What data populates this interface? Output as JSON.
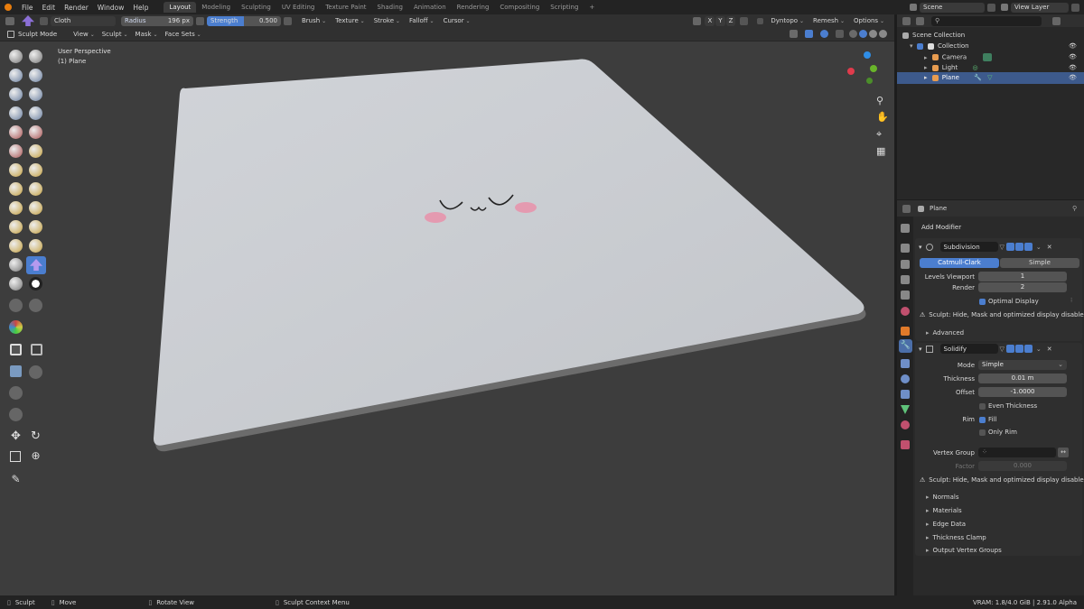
{
  "topbar": {
    "menus": [
      "File",
      "Edit",
      "Render",
      "Window",
      "Help"
    ],
    "workspaces": [
      "Layout",
      "Modeling",
      "Sculpting",
      "UV Editing",
      "Texture Paint",
      "Shading",
      "Animation",
      "Rendering",
      "Compositing",
      "Scripting"
    ],
    "active_workspace": "Layout",
    "add_tab": "+",
    "scene": "Scene",
    "view_layer": "View Layer"
  },
  "tool_header": {
    "brush_name": "Cloth",
    "radius_label": "Radius",
    "radius_value": "196 px",
    "strength_label": "Strength",
    "strength_value": "0.500",
    "menus": [
      "Brush",
      "Texture",
      "Stroke",
      "Falloff",
      "Cursor"
    ],
    "axes": [
      "X",
      "Y",
      "Z"
    ],
    "dyntopo": "Dyntopo",
    "remesh": "Remesh",
    "options": "Options"
  },
  "viewport_header": {
    "mode": "Sculpt Mode",
    "menus": [
      "View",
      "Sculpt",
      "Mask",
      "Face Sets"
    ]
  },
  "viewport": {
    "perspective": "User Perspective",
    "object": "(1) Plane",
    "face_text": "◡ ‿ ◡"
  },
  "outliner": {
    "root": "Scene Collection",
    "collection": "Collection",
    "items": [
      "Camera",
      "Light",
      "Plane"
    ],
    "search_placeholder": ""
  },
  "properties": {
    "object_name": "Plane",
    "add_modifier": "Add Modifier",
    "subdivision": {
      "name": "Subdivision",
      "tab_catmull": "Catmull-Clark",
      "tab_simple": "Simple",
      "levels_viewport_label": "Levels Viewport",
      "levels_viewport": "1",
      "render_label": "Render",
      "render": "2",
      "optimal_display": "Optimal Display",
      "warning": "Sculpt: Hide, Mask and optimized display disabled",
      "advanced": "Advanced"
    },
    "solidify": {
      "name": "Solidify",
      "mode_label": "Mode",
      "mode": "Simple",
      "thickness_label": "Thickness",
      "thickness": "0.01 m",
      "offset_label": "Offset",
      "offset": "-1.0000",
      "even_thickness": "Even Thickness",
      "rim_label": "Rim",
      "fill": "Fill",
      "only_rim": "Only Rim",
      "vertex_group_label": "Vertex Group",
      "factor_label": "Factor",
      "factor": "0.000",
      "warning": "Sculpt: Hide, Mask and optimized display disabled",
      "subpanels": [
        "Normals",
        "Materials",
        "Edge Data",
        "Thickness Clamp",
        "Output Vertex Groups"
      ]
    }
  },
  "statusbar": {
    "sculpt": "Sculpt",
    "move": "Move",
    "rotate": "Rotate View",
    "context": "Sculpt Context Menu",
    "info": "VRAM: 1.8/4.0 GiB | 2.91.0 Alpha"
  },
  "colors": {
    "accent": "#4b7ecf",
    "plane": "#ced1d6",
    "blush": "#e49ab0"
  }
}
